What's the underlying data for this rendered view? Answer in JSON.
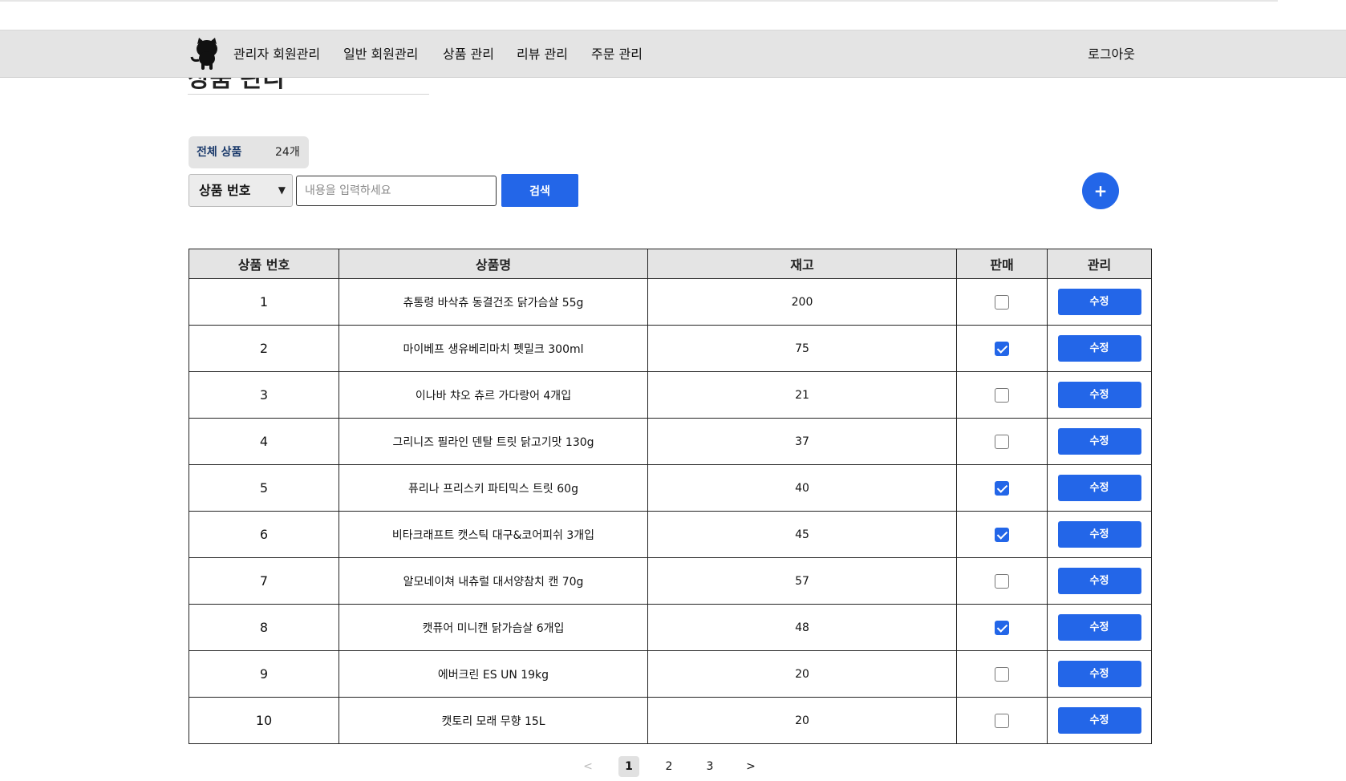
{
  "page": {
    "title": "상품 관리"
  },
  "nav": {
    "logo_icon": "github-octocat-icon",
    "items": [
      "관리자 회원관리",
      "일반 회원관리",
      "상품 관리",
      "리뷰 관리",
      "주문 관리"
    ],
    "logout": "로그아웃"
  },
  "summary": {
    "label": "전체 상품",
    "count": "24개"
  },
  "search": {
    "selected_field": "상품 번호",
    "placeholder": "내용을 입력하세요",
    "value": "",
    "button": "검색",
    "add_button": "+"
  },
  "table": {
    "headers": [
      "상품 번호",
      "상품명",
      "재고",
      "판매",
      "관리"
    ],
    "edit_label": "수정",
    "rows": [
      {
        "id": "1",
        "name": "츄통령 바삭츄 동결건조 닭가슴살 55g",
        "stock": "200",
        "on_sale": false
      },
      {
        "id": "2",
        "name": "마이베프 생유베리마치 펫밀크 300ml",
        "stock": "75",
        "on_sale": true
      },
      {
        "id": "3",
        "name": "이나바 챠오 츄르 가다랑어 4개입",
        "stock": "21",
        "on_sale": false
      },
      {
        "id": "4",
        "name": "그리니즈 필라인 덴탈 트릿 닭고기맛 130g",
        "stock": "37",
        "on_sale": false
      },
      {
        "id": "5",
        "name": "퓨리나 프리스키 파티믹스 트릿 60g",
        "stock": "40",
        "on_sale": true
      },
      {
        "id": "6",
        "name": "비타크래프트 캣스틱 대구&코어피쉬 3개입",
        "stock": "45",
        "on_sale": true
      },
      {
        "id": "7",
        "name": "알모네이쳐 내츄럴 대서양참치 캔 70g",
        "stock": "57",
        "on_sale": false
      },
      {
        "id": "8",
        "name": "캣퓨어 미니캔 닭가슴살 6개입",
        "stock": "48",
        "on_sale": true
      },
      {
        "id": "9",
        "name": "에버크린 ES UN 19kg",
        "stock": "20",
        "on_sale": false
      },
      {
        "id": "10",
        "name": "캣토리 모래 무향 15L",
        "stock": "20",
        "on_sale": false
      }
    ]
  },
  "pagination": {
    "prev": "<",
    "pages": [
      "1",
      "2",
      "3"
    ],
    "current": "1",
    "next": ">"
  },
  "colors": {
    "accent": "#2366e8",
    "nav_bg": "#e4e4e4"
  }
}
